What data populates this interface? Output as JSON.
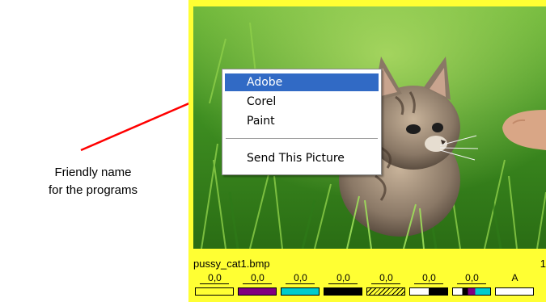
{
  "annotation": {
    "line1": "Friendly name",
    "line2": "for the programs",
    "arrow_color": "#ff0000"
  },
  "viewer": {
    "frame_color": "#ffff33",
    "image_subject": "kitten in grass",
    "filename": "pussy_cat1.bmp",
    "counter": "1"
  },
  "context_menu": {
    "items": [
      {
        "label": "Adobe",
        "selected": true
      },
      {
        "label": "Corel",
        "selected": false
      },
      {
        "label": "Paint",
        "selected": false
      },
      {
        "label": "Send This Picture",
        "selected": false
      }
    ],
    "highlight_color": "#316ac5"
  },
  "channels": [
    {
      "value": "0,0",
      "swatch_color": "#ffff33"
    },
    {
      "value": "0,0",
      "swatch_color": "#800080"
    },
    {
      "value": "0,0",
      "swatch_color": "#00cccc"
    },
    {
      "value": "0,0",
      "swatch_color": "#000000"
    },
    {
      "value": "0,0",
      "swatch_color": "#ffff33",
      "pattern": "hatched"
    },
    {
      "value": "0,0",
      "swatch_color": "#ffffff",
      "pattern": "white-black"
    },
    {
      "value": "0,0",
      "swatch_color": "#00cccc",
      "pattern": "mixed"
    },
    {
      "value": "A",
      "swatch_color": "#ffffff"
    }
  ]
}
